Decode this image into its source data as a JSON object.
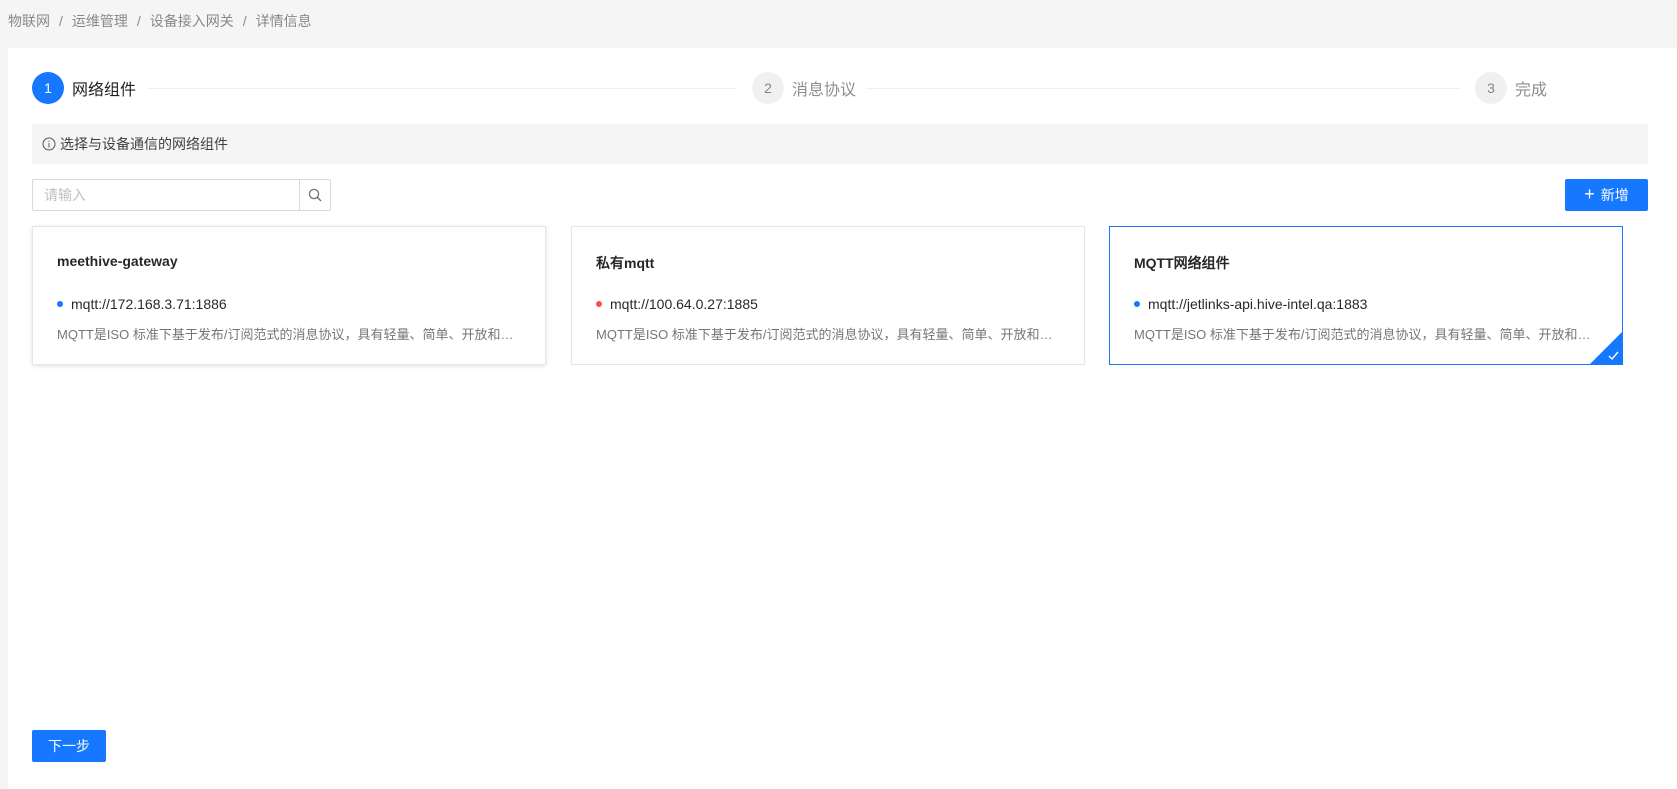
{
  "breadcrumb": {
    "items": [
      "物联网",
      "运维管理",
      "设备接入网关",
      "详情信息"
    ],
    "separator": "/"
  },
  "steps": [
    {
      "num": "1",
      "title": "网络组件",
      "status": "active"
    },
    {
      "num": "2",
      "title": "消息协议",
      "status": "wait"
    },
    {
      "num": "3",
      "title": "完成",
      "status": "wait"
    }
  ],
  "alert": {
    "text": "选择与设备通信的网络组件",
    "icon": "info-circle-icon"
  },
  "search": {
    "placeholder": "请输入",
    "value": "",
    "icon": "search-icon"
  },
  "add_button": {
    "label": "新增",
    "icon": "plus-icon"
  },
  "cards": [
    {
      "name": "meethive-gateway",
      "address": "mqtt://172.168.3.71:1886",
      "status_color": "#1677ff",
      "description": "MQTT是ISO 标准下基于发布/订阅范式的消息协议，具有轻量、简单、开放和易于实现等特点",
      "selected": false
    },
    {
      "name": "私有mqtt",
      "address": "mqtt://100.64.0.27:1885",
      "status_color": "#ff4d4f",
      "description": "MQTT是ISO 标准下基于发布/订阅范式的消息协议，具有轻量、简单、开放和易于实现等特点",
      "selected": false
    },
    {
      "name": "MQTT网络组件",
      "address": "mqtt://jetlinks-api.hive-intel.qa:1883",
      "status_color": "#1677ff",
      "description": "MQTT是ISO 标准下基于发布/订阅范式的消息协议，具有轻量、简单、开放和易于实现等特点",
      "selected": true
    }
  ],
  "next_button": {
    "label": "下一步"
  },
  "colors": {
    "primary": "#1677ff",
    "error": "#ff4d4f"
  }
}
